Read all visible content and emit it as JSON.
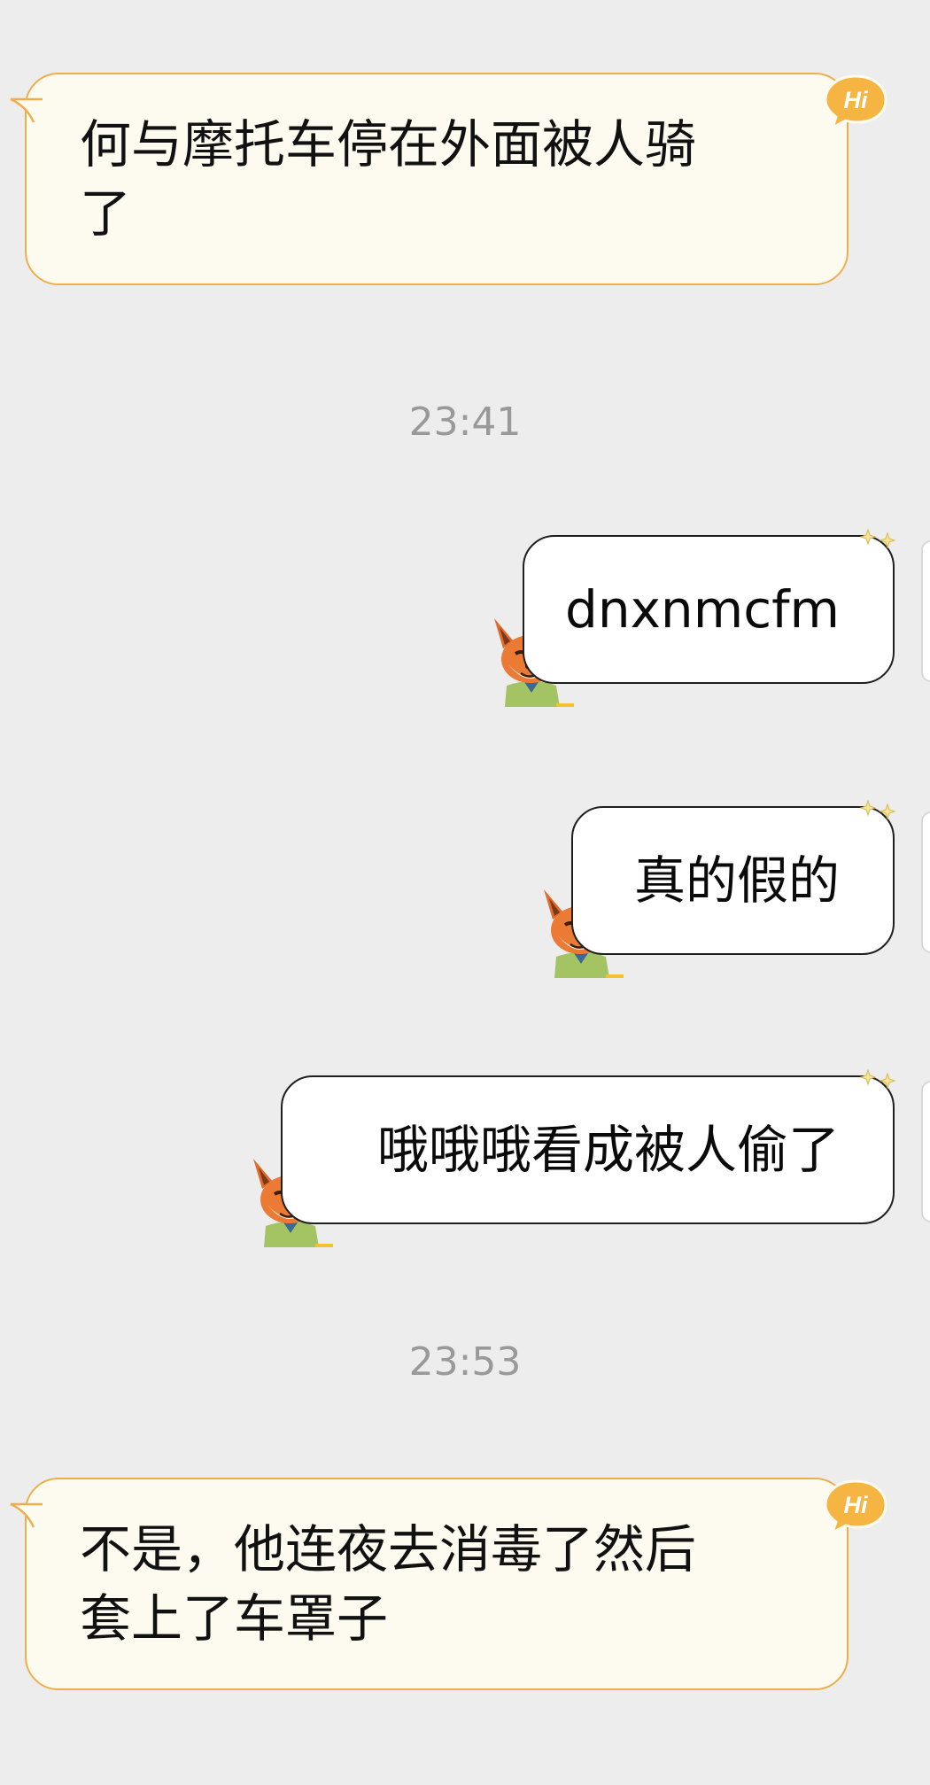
{
  "messages": [
    {
      "direction": "incoming",
      "text_lines": [
        "何与摩托车停在外面被人骑",
        "了"
      ],
      "badge": "Hi"
    },
    {
      "timestamp": "23:41"
    },
    {
      "direction": "outgoing",
      "text": "dnxnmcfm"
    },
    {
      "direction": "outgoing",
      "text": "真的假的"
    },
    {
      "direction": "outgoing",
      "text": "哦哦哦看成被人偷了"
    },
    {
      "timestamp": "23:53"
    },
    {
      "direction": "incoming",
      "text_lines": [
        "不是，他连夜去消毒了然后",
        "套上了车罩子"
      ],
      "badge": "Hi"
    }
  ],
  "colors": {
    "background": "#ededed",
    "incoming_bubble": "#fdfbef",
    "incoming_border": "#efae4e",
    "outgoing_bubble": "#ffffff",
    "outgoing_border": "#1f1f1f",
    "timestamp_text": "#999999",
    "badge_fill": "#f6b443"
  },
  "icons": {
    "incoming_badge": "hi-badge-icon",
    "outgoing_avatar": "fox-sticker-icon",
    "outgoing_decoration": "sparkle-stars-icon"
  }
}
